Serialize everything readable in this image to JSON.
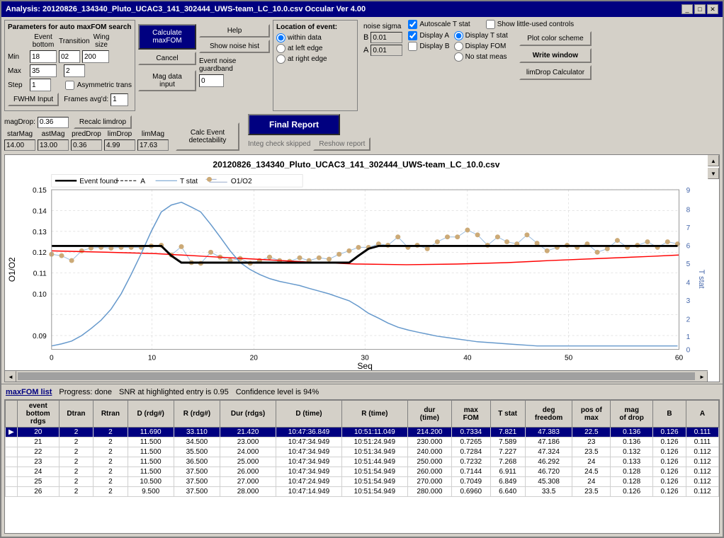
{
  "window": {
    "title": "Analysis: 20120826_134340_Pluto_UCAC3_141_302444_UWS-team_LC_10.0.csv  Occular Ver 4.00",
    "buttons": [
      "_",
      "□",
      "✕"
    ]
  },
  "params": {
    "section_title": "Parameters for auto maxFOM search",
    "event_bottom": "Event bottom",
    "transition": "Transition",
    "wing_size": "Wing size",
    "min_label": "Min",
    "max_label": "Max",
    "step_label": "Step",
    "min1_val": "18",
    "max1_val": "35",
    "step1_val": "1",
    "min2_val": "02",
    "max2_val": "2",
    "wing_val": "200",
    "asymmetric_label": "Asymmetric trans",
    "fwhm_btn": "FWHM Input",
    "frames_label": "Frames avg'd:",
    "frames_val": "1"
  },
  "calc": {
    "calculate_btn": "Calculate\nmaxFOM",
    "cancel_btn": "Cancel",
    "mag_data_btn": "Mag data input"
  },
  "noise": {
    "show_noise_btn": "Show noise hist",
    "event_noise_label": "Event noise\nguardband",
    "guardband_val": "0",
    "noise_sigma_label": "noise sigma",
    "b_label": "B",
    "a_label": "A",
    "b_val": "0.01",
    "a_val": "0.01"
  },
  "event_location": {
    "title": "Location of event:",
    "within_data": "within data",
    "at_left_edge": "at left edge",
    "at_right_edge": "at right edge",
    "selected": "within_data"
  },
  "right_controls": {
    "autoscale_label": "Autoscale T stat",
    "show_little_label": "Show little-used controls",
    "display_a": "Display A",
    "display_b": "Display B",
    "display_t": "Display T stat",
    "display_fom": "Display FOM",
    "no_stat": "No stat meas",
    "plot_color_btn": "Plot color scheme",
    "write_window_btn": "Write window",
    "limdrop_btn": "limDrop Calculator"
  },
  "show_noise": {
    "label": "Show noise"
  },
  "mag_section": {
    "magdrop_label": "magDrop:",
    "magdrop_val": "0.36",
    "recalc_btn": "Recalc limdrop",
    "calc_event_btn": "Calc Event\ndetectability",
    "starmag_label": "starMag",
    "astmag_label": "astMag",
    "preddrop_label": "predDrop",
    "limdrop_label": "limDrop",
    "limmag_label": "limMag",
    "starmag_val": "14.00",
    "astmag_val": "13.00",
    "preddrop_val": "0.36",
    "limdrop_val": "4.99",
    "limmag_val": "17.63"
  },
  "integ": {
    "final_report_btn": "Final Report",
    "integ_label": "Integ check skipped",
    "reshow_btn": "Reshow report"
  },
  "chart": {
    "title": "20120826_134340_Pluto_UCAC3_141_302444_UWS-team_LC_10.0.csv",
    "x_label": "Seq",
    "y_left_label": "O1/O2",
    "y_right_label": "T stat",
    "legend": {
      "event_found": "Event found",
      "a": "A",
      "t_stat": "T stat",
      "o1o2": "O1/O2"
    },
    "x_min": 0,
    "x_max": 60,
    "y_min": 0.09,
    "y_max": 0.15,
    "t_min": 0,
    "t_max": 9
  },
  "status": {
    "tab_label": "maxFOM list",
    "progress": "Progress: done",
    "snr_text": "SNR at highlighted entry is 0.95",
    "confidence": "Confidence level is 94%"
  },
  "table": {
    "columns": [
      "event bottom rdgs",
      "Dtran",
      "Rtran",
      "D (rdg#)",
      "R (rdg#)",
      "Dur (rdgs)",
      "D (time)",
      "R (time)",
      "dur (time)",
      "max FOM",
      "T stat",
      "deg freedom",
      "pos of max",
      "mag of drop",
      "B",
      "A"
    ],
    "rows": [
      {
        "arrow": "▶",
        "event_bottom": "20",
        "dtran": "2",
        "rtran": "2",
        "d_rdg": "11.690",
        "r_rdg": "33.110",
        "dur_rdgs": "21.420",
        "d_time": "10:47:36.849",
        "r_time": "10:51:11.049",
        "dur_time": "214.200",
        "max_fom": "0.7334",
        "t_stat": "7.821",
        "deg_free": "47.383",
        "pos_max": "22.5",
        "mag_drop": "0.136",
        "b": "0.126",
        "a": "0.111",
        "highlighted": true
      },
      {
        "arrow": "",
        "event_bottom": "21",
        "dtran": "2",
        "rtran": "2",
        "d_rdg": "11.500",
        "r_rdg": "34.500",
        "dur_rdgs": "23.000",
        "d_time": "10:47:34.949",
        "r_time": "10:51:24.949",
        "dur_time": "230.000",
        "max_fom": "0.7265",
        "t_stat": "7.589",
        "deg_free": "47.186",
        "pos_max": "23",
        "mag_drop": "0.136",
        "b": "0.126",
        "a": "0.111",
        "highlighted": false
      },
      {
        "arrow": "",
        "event_bottom": "22",
        "dtran": "2",
        "rtran": "2",
        "d_rdg": "11.500",
        "r_rdg": "35.500",
        "dur_rdgs": "24.000",
        "d_time": "10:47:34.949",
        "r_time": "10:51:34.949",
        "dur_time": "240.000",
        "max_fom": "0.7284",
        "t_stat": "7.227",
        "deg_free": "47.324",
        "pos_max": "23.5",
        "mag_drop": "0.132",
        "b": "0.126",
        "a": "0.112",
        "highlighted": false
      },
      {
        "arrow": "",
        "event_bottom": "23",
        "dtran": "2",
        "rtran": "2",
        "d_rdg": "11.500",
        "r_rdg": "36.500",
        "dur_rdgs": "25.000",
        "d_time": "10:47:34.949",
        "r_time": "10:51:44.949",
        "dur_time": "250.000",
        "max_fom": "0.7232",
        "t_stat": "7.268",
        "deg_free": "46.292",
        "pos_max": "24",
        "mag_drop": "0.133",
        "b": "0.126",
        "a": "0.112",
        "highlighted": false
      },
      {
        "arrow": "",
        "event_bottom": "24",
        "dtran": "2",
        "rtran": "2",
        "d_rdg": "11.500",
        "r_rdg": "37.500",
        "dur_rdgs": "26.000",
        "d_time": "10:47:34.949",
        "r_time": "10:51:54.949",
        "dur_time": "260.000",
        "max_fom": "0.7144",
        "t_stat": "6.911",
        "deg_free": "46.720",
        "pos_max": "24.5",
        "mag_drop": "0.128",
        "b": "0.126",
        "a": "0.112",
        "highlighted": false
      },
      {
        "arrow": "",
        "event_bottom": "25",
        "dtran": "2",
        "rtran": "2",
        "d_rdg": "10.500",
        "r_rdg": "37.500",
        "dur_rdgs": "27.000",
        "d_time": "10:47:24.949",
        "r_time": "10:51:54.949",
        "dur_time": "270.000",
        "max_fom": "0.7049",
        "t_stat": "6.849",
        "deg_free": "45.308",
        "pos_max": "24",
        "mag_drop": "0.128",
        "b": "0.126",
        "a": "0.112",
        "highlighted": false
      },
      {
        "arrow": "",
        "event_bottom": "26",
        "dtran": "2",
        "rtran": "2",
        "d_rdg": "9.500",
        "r_rdg": "37.500",
        "dur_rdgs": "28.000",
        "d_time": "10:47:14.949",
        "r_time": "10:51:54.949",
        "dur_time": "280.000",
        "max_fom": "0.6960",
        "t_stat": "6.640",
        "deg_free": "33.5",
        "pos_max": "23.5",
        "mag_drop": "0.126",
        "b": "0.126",
        "a": "0.112",
        "highlighted": false
      }
    ]
  }
}
